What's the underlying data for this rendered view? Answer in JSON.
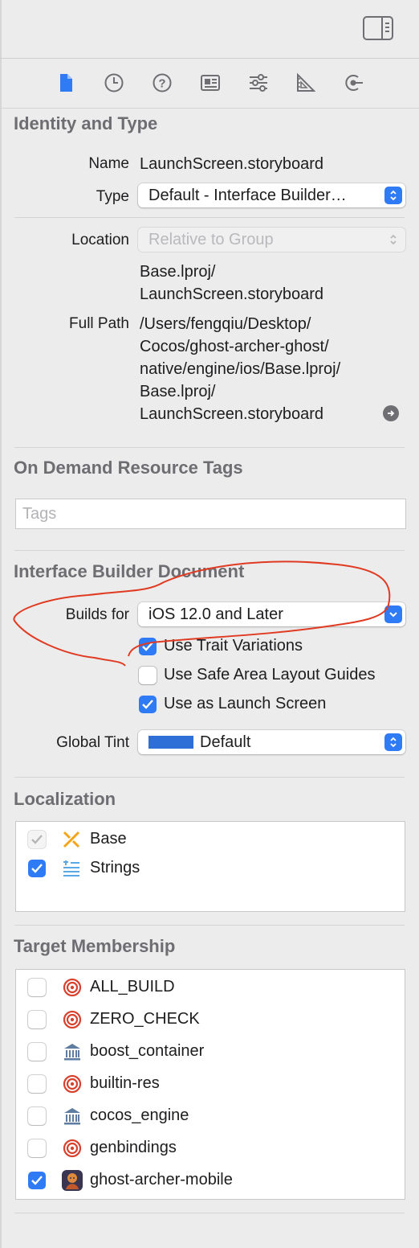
{
  "colors": {
    "accent": "#2f7bf5",
    "tint_swatch": "#2d6fd6",
    "annotation": "#e03b22",
    "target_icon": "#d8412f",
    "library_icon": "#5f7da0"
  },
  "toolbar": {
    "toggle_icon": "sidebar-right-icon",
    "tabs": [
      "file-inspector-icon",
      "history-icon",
      "help-icon",
      "identity-icon",
      "attributes-icon",
      "size-icon",
      "connections-icon"
    ]
  },
  "identity": {
    "title": "Identity and Type",
    "name_label": "Name",
    "name_value": "LaunchScreen.storyboard",
    "type_label": "Type",
    "type_value": "Default - Interface Builder…",
    "location_label": "Location",
    "location_value": "Relative to Group",
    "location_path": [
      "Base.lproj/",
      "LaunchScreen.storyboard"
    ],
    "full_path_label": "Full Path",
    "full_path": [
      "/Users/fengqiu/Desktop/",
      "Cocos/ghost-archer-ghost/",
      "native/engine/ios/Base.lproj/",
      "Base.lproj/",
      "LaunchScreen.storyboard"
    ]
  },
  "odr": {
    "title": "On Demand Resource Tags",
    "tags_placeholder": "Tags"
  },
  "ib": {
    "title": "Interface Builder Document",
    "builds_for_label": "Builds for",
    "builds_for_value": "iOS 12.0 and Later",
    "options": [
      {
        "label": "Use Trait Variations",
        "checked": true
      },
      {
        "label": "Use Safe Area Layout Guides",
        "checked": false
      },
      {
        "label": "Use as Launch Screen",
        "checked": true
      }
    ],
    "global_tint_label": "Global Tint",
    "global_tint_value": "Default"
  },
  "localization": {
    "title": "Localization",
    "items": [
      {
        "label": "Base",
        "checked": true,
        "disabled": true,
        "icon": "base-localization-icon"
      },
      {
        "label": "Strings",
        "checked": true,
        "disabled": false,
        "icon": "strings-icon"
      }
    ]
  },
  "targets": {
    "title": "Target Membership",
    "items": [
      {
        "label": "ALL_BUILD",
        "checked": false,
        "icon": "target-icon"
      },
      {
        "label": "ZERO_CHECK",
        "checked": false,
        "icon": "target-icon"
      },
      {
        "label": "boost_container",
        "checked": false,
        "icon": "library-icon"
      },
      {
        "label": "builtin-res",
        "checked": false,
        "icon": "target-icon"
      },
      {
        "label": "cocos_engine",
        "checked": false,
        "icon": "library-icon"
      },
      {
        "label": "genbindings",
        "checked": false,
        "icon": "target-icon"
      },
      {
        "label": "ghost-archer-mobile",
        "checked": true,
        "icon": "app-icon"
      }
    ]
  }
}
